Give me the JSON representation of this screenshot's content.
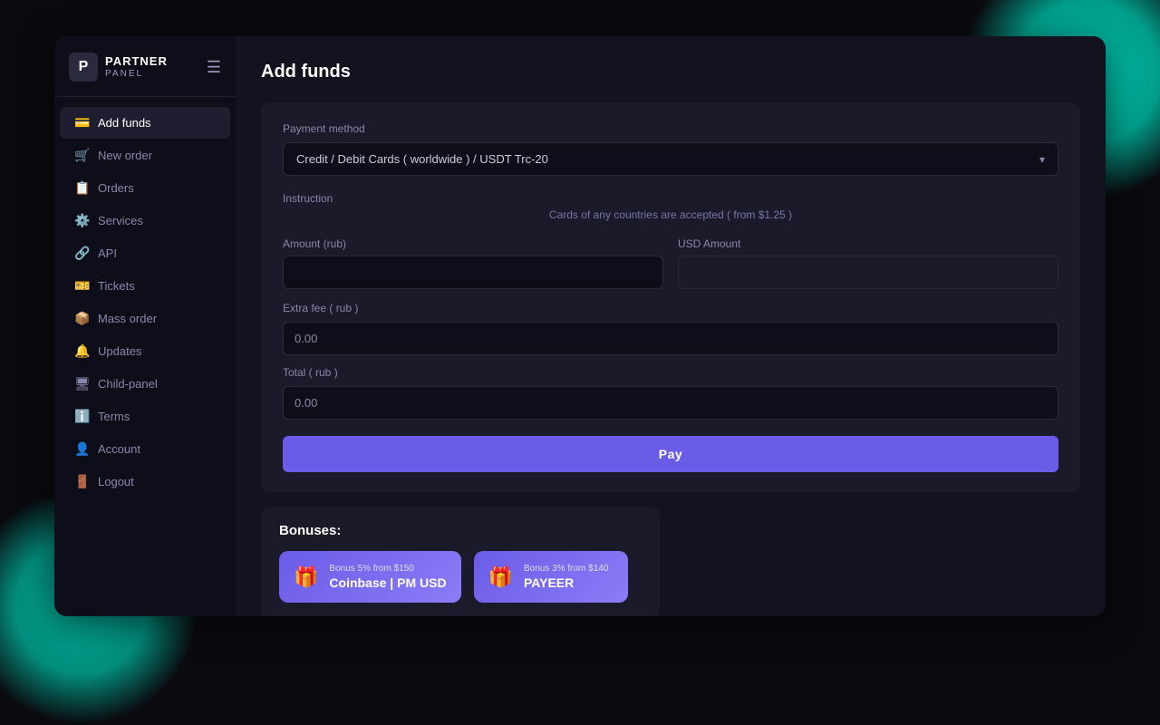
{
  "app": {
    "logo_letter": "P",
    "logo_partner": "PARTNER",
    "logo_panel": "PANEL"
  },
  "sidebar": {
    "items": [
      {
        "id": "add-funds",
        "label": "Add funds",
        "icon": "💳",
        "active": true
      },
      {
        "id": "new-order",
        "label": "New order",
        "icon": "🛒",
        "active": false
      },
      {
        "id": "orders",
        "label": "Orders",
        "icon": "📋",
        "active": false
      },
      {
        "id": "services",
        "label": "Services",
        "icon": "⚙️",
        "active": false
      },
      {
        "id": "api",
        "label": "API",
        "icon": "🔗",
        "active": false
      },
      {
        "id": "tickets",
        "label": "Tickets",
        "icon": "🎫",
        "active": false
      },
      {
        "id": "mass-order",
        "label": "Mass order",
        "icon": "📦",
        "active": false
      },
      {
        "id": "updates",
        "label": "Updates",
        "icon": "🔔",
        "active": false
      },
      {
        "id": "child-panel",
        "label": "Child-panel",
        "icon": "🖥",
        "active": false
      },
      {
        "id": "terms",
        "label": "Terms",
        "icon": "ℹ️",
        "active": false
      },
      {
        "id": "account",
        "label": "Account",
        "icon": "👤",
        "active": false
      },
      {
        "id": "logout",
        "label": "Logout",
        "icon": "🚪",
        "active": false
      }
    ]
  },
  "page": {
    "title": "Add funds",
    "payment_method_label": "Payment method",
    "payment_method_value": "Credit / Debit Cards ( worldwide ) / USDT Trc-20",
    "instruction_label": "Instruction",
    "instruction_text": "Cards of any countries are accepted ( from $1.25 )",
    "amount_rub_label": "Amount (rub)",
    "amount_rub_placeholder": "",
    "usd_amount_label": "USD Amount",
    "usd_amount_placeholder": "",
    "extra_fee_label": "Extra fee ( rub )",
    "extra_fee_value": "0.00",
    "total_label": "Total ( rub )",
    "total_value": "0.00",
    "pay_button": "Pay"
  },
  "bonuses": {
    "title": "Bonuses:",
    "items": [
      {
        "id": "coinbase",
        "sub_label": "Bonus 5% from $150",
        "name": "Coinbase | PM USD",
        "icon": "🎁"
      },
      {
        "id": "payeer",
        "sub_label": "Bonus 3% from $140",
        "name": "PAYEER",
        "icon": "🎁"
      }
    ]
  }
}
